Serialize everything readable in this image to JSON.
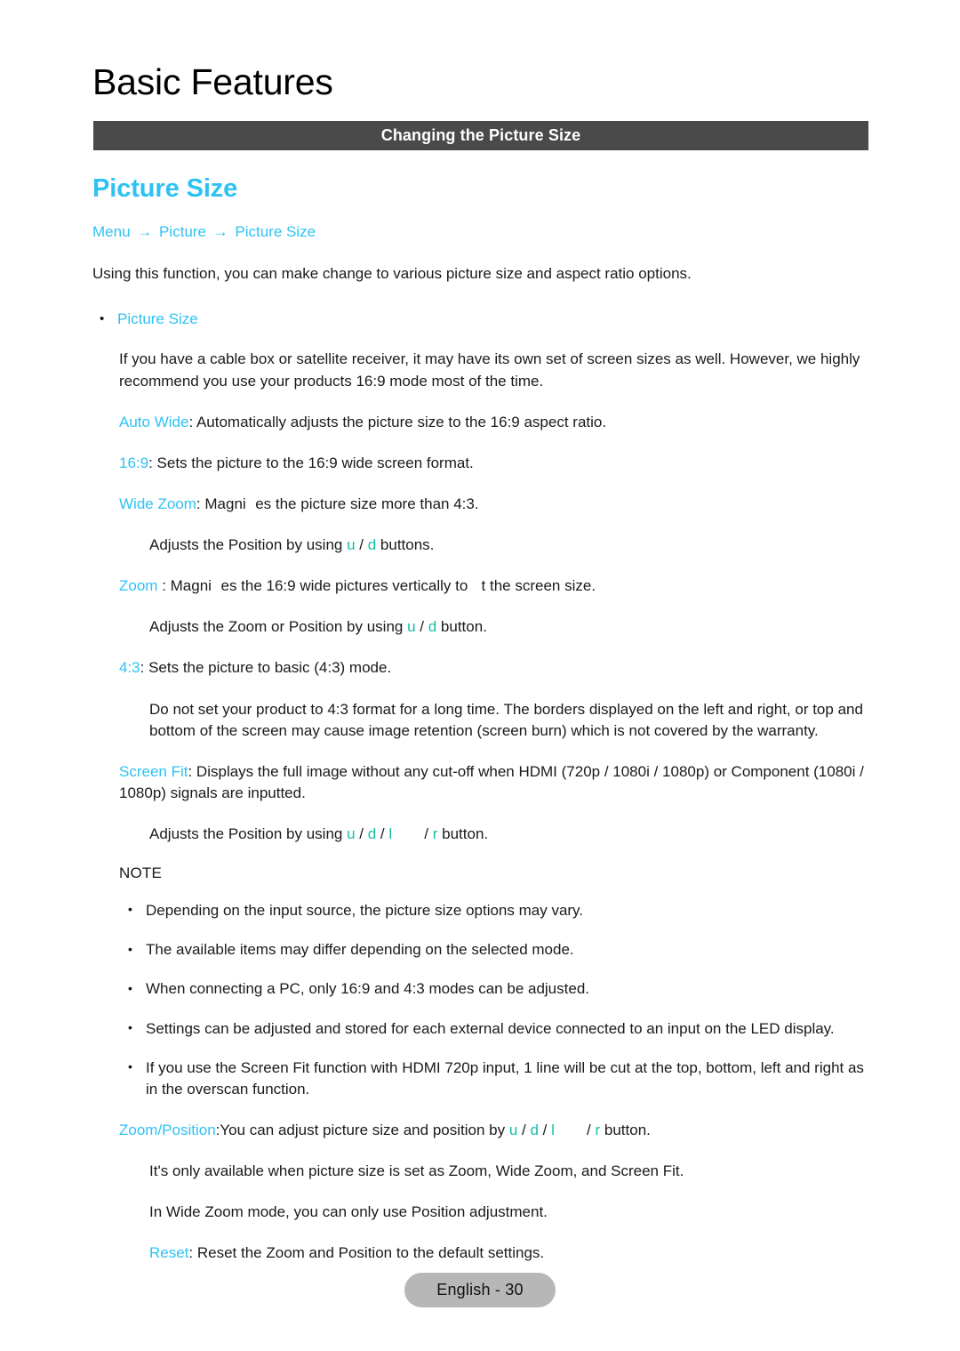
{
  "chapter": {
    "title": "Basic Features"
  },
  "section_banner": {
    "label": "Changing the Picture Size",
    "background_color": "#4a4a4a",
    "text_color": "#ffffff"
  },
  "colors": {
    "accent_cyan": "#2ec2f3",
    "accent_teal": "#13bfa6",
    "body_text": "#1a1a1a",
    "footer_pill": "#b7b7b7"
  },
  "feature": {
    "heading": "Picture Size",
    "breadcrumb": {
      "items": [
        "Menu",
        "Picture",
        "Picture Size"
      ],
      "separator": "→"
    },
    "intro": "Using this function, you can make change to various picture size and aspect ratio options.",
    "bullet_label": "Picture Size",
    "bullet_marker": "•",
    "cable_box_note": "If you have a cable box or satellite receiver, it may have its own set of screen sizes as well. However, we highly recommend you use your products 16:9 mode most of the time."
  },
  "options": {
    "auto_wide": {
      "term": "Auto Wide",
      "description": ": Automatically adjusts the picture size to the 16:9 aspect ratio."
    },
    "sixteen_nine": {
      "term": "16:9",
      "description": ": Sets the picture to the 16:9 wide screen format."
    },
    "wide_zoom": {
      "term": "Wide Zoom",
      "description_before": ": Magni",
      "description_after": "es the picture size more than 4:3.",
      "adjust_before": "Adjusts the Position by using ",
      "adjust_key_1": "u",
      "adjust_sep": " / ",
      "adjust_key_2": "d",
      "adjust_after": " buttons."
    },
    "zoom": {
      "term": "Zoom",
      "description_before": " : Magni",
      "description_mid": "es the 16:9 wide pictures vertically to ",
      "description_after": "t the screen size.",
      "adjust_before": "Adjusts the Zoom or Position by using ",
      "adjust_key_1": "u",
      "adjust_sep": " / ",
      "adjust_key_2": "d",
      "adjust_after": " button."
    },
    "four_three": {
      "term": "4:3",
      "description": ": Sets the picture to basic (4:3) mode.",
      "warning": "Do not set your product to 4:3 format for a long time. The borders displayed on the left and right, or top and bottom of the screen may cause image retention (screen burn) which is not covered by the warranty."
    },
    "screen_fit": {
      "term": "Screen Fit",
      "description": ": Displays the full image without any cut-off when HDMI (720p / 1080i / 1080p) or Component (1080i / 1080p) signals are inputted.",
      "adjust_before": "Adjusts the Position by using ",
      "adjust_key_1": "u",
      "adjust_sep_1": " / ",
      "adjust_key_2": "d",
      "adjust_sep_2": " / ",
      "adjust_key_3": "l",
      "adjust_sep_3": " / ",
      "adjust_key_4": "r",
      "adjust_after": "  button."
    }
  },
  "note": {
    "label": "NOTE",
    "bullet_marker": "•",
    "items": [
      "Depending on the input source, the picture size options may vary.",
      "The available items may differ depending on the selected mode.",
      "When connecting a PC, only 16:9 and 4:3 modes can be adjusted.",
      "Settings can be adjusted and stored for each external device connected to an input on the LED display.",
      "If you use the Screen Fit function with HDMI 720p input, 1 line will be cut at the top, bottom, left and right as in the overscan function."
    ]
  },
  "zoom_position": {
    "term": "Zoom/Position",
    "description_before": ":You can adjust picture size and position by ",
    "key_1": "u",
    "sep_1": " / ",
    "key_2": "d",
    "sep_2": " / ",
    "key_3": "l",
    "sep_3": " / ",
    "key_4": "r",
    "description_after": "  button.",
    "availability": "It's only available when picture size is set as Zoom, Wide Zoom, and Screen Fit.",
    "wide_zoom_note": "In Wide Zoom mode, you can only use Position adjustment.",
    "reset_term": "Reset",
    "reset_description": ": Reset the Zoom and Position to the default settings."
  },
  "footer": {
    "page_label": "English - 30"
  }
}
